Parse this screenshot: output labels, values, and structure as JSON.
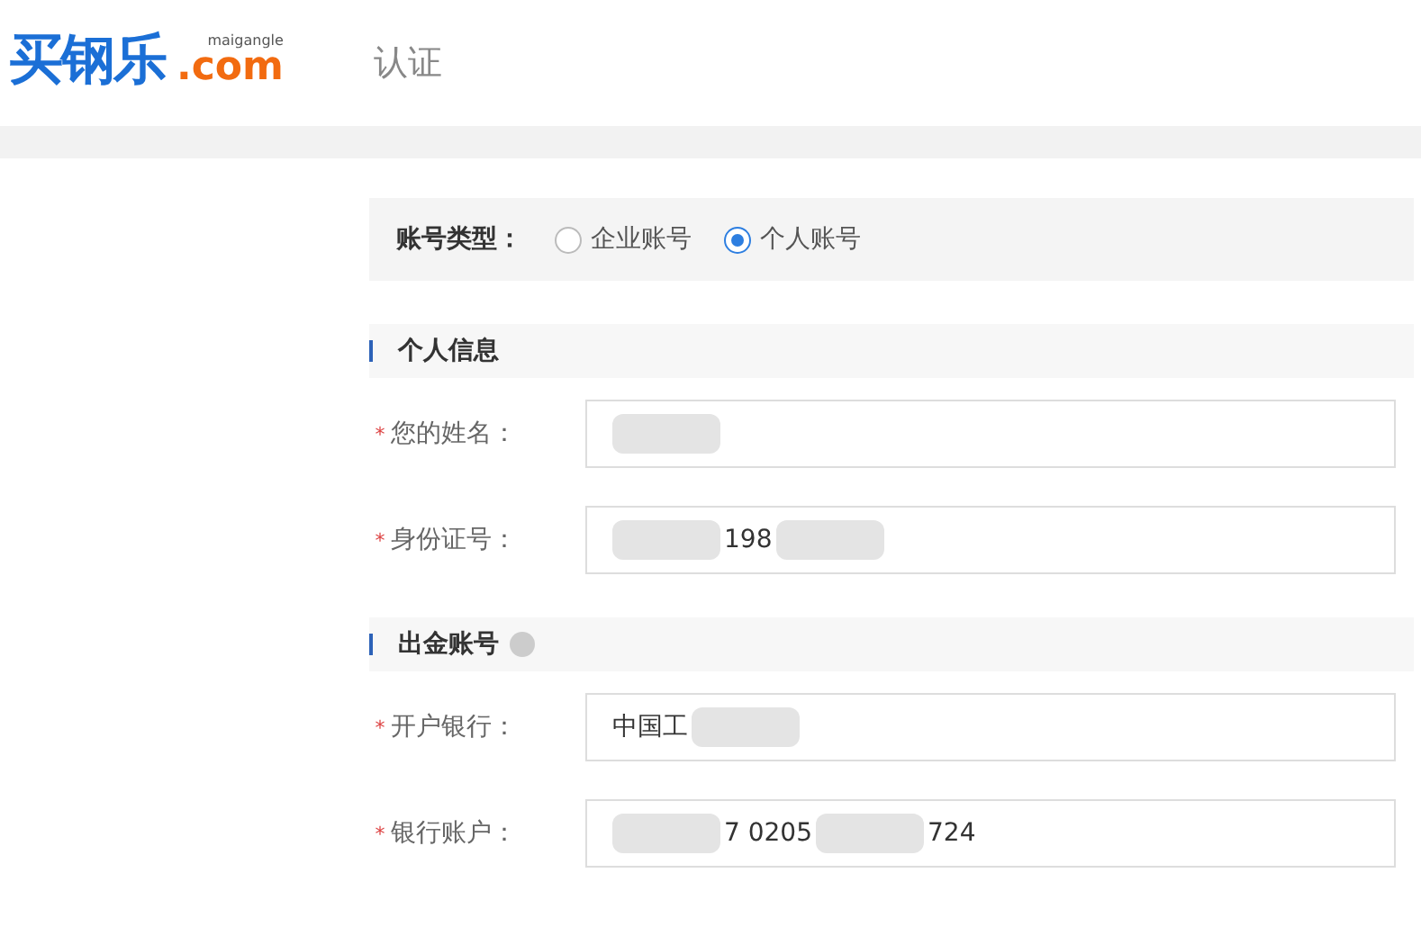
{
  "header": {
    "logo": {
      "name": "买钢乐",
      "pinyin": "maigangle",
      "domain": ".com"
    },
    "title": "认证"
  },
  "account_type": {
    "label": "账号类型：",
    "options": [
      {
        "label": "企业账号",
        "selected": false
      },
      {
        "label": "个人账号",
        "selected": true
      }
    ]
  },
  "sections": [
    {
      "title": "个人信息",
      "info": false,
      "fields": [
        {
          "label": "您的姓名：",
          "mark": "*",
          "value": [
            {
              "kind": "redacted"
            }
          ]
        },
        {
          "label": "身份证号：",
          "mark": "*",
          "value": [
            {
              "kind": "redacted"
            },
            {
              "kind": "text",
              "text": "198"
            },
            {
              "kind": "redacted"
            }
          ]
        }
      ]
    },
    {
      "title": "出金账号",
      "info": true,
      "fields": [
        {
          "label": "开户银行：",
          "mark": "*",
          "value": [
            {
              "kind": "text",
              "text": "中国工"
            },
            {
              "kind": "redacted"
            }
          ]
        },
        {
          "label": "银行账户：",
          "mark": "*",
          "value": [
            {
              "kind": "redacted"
            },
            {
              "kind": "text",
              "text": "7 0205"
            },
            {
              "kind": "redacted"
            },
            {
              "kind": "text",
              "text": "724"
            }
          ]
        }
      ]
    }
  ]
}
